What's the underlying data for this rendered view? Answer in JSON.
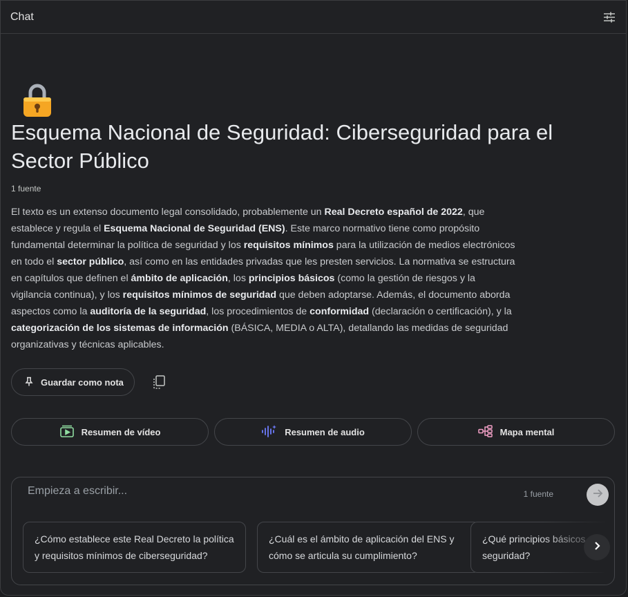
{
  "header": {
    "title": "Chat",
    "settings_icon": "tune-sliders-icon"
  },
  "notebook": {
    "emoji_icon": "lock-icon",
    "title": "Esquema Nacional de Seguridad: Ciberseguridad para el Sector Público",
    "source_count": "1 fuente",
    "summary_parts": [
      {
        "t": "El texto es un extenso documento legal consolidado, probablemente un ",
        "b": false
      },
      {
        "t": "Real Decreto español de 2022",
        "b": true
      },
      {
        "t": ", que establece y regula el ",
        "b": false
      },
      {
        "t": "Esquema Nacional de Seguridad (ENS)",
        "b": true
      },
      {
        "t": ". Este marco normativo tiene como propósito fundamental determinar la política de seguridad y los ",
        "b": false
      },
      {
        "t": "requisitos mínimos",
        "b": true
      },
      {
        "t": " para la utilización de medios electrónicos en todo el ",
        "b": false
      },
      {
        "t": "sector público",
        "b": true
      },
      {
        "t": ", así como en las entidades privadas que les presten servicios. La normativa se estructura en capítulos que definen el ",
        "b": false
      },
      {
        "t": "ámbito de aplicación",
        "b": true
      },
      {
        "t": ", los ",
        "b": false
      },
      {
        "t": "principios básicos",
        "b": true
      },
      {
        "t": " (como la gestión de riesgos y la vigilancia continua), y los ",
        "b": false
      },
      {
        "t": "requisitos mínimos de seguridad",
        "b": true
      },
      {
        "t": " que deben adoptarse. Además, el documento aborda aspectos como la ",
        "b": false
      },
      {
        "t": "auditoría de la seguridad",
        "b": true
      },
      {
        "t": ", los procedimientos de ",
        "b": false
      },
      {
        "t": "conformidad",
        "b": true
      },
      {
        "t": " (declaración o certificación), y la ",
        "b": false
      },
      {
        "t": "categorización de los sistemas de información",
        "b": true
      },
      {
        "t": " (BÁSICA, MEDIA o ALTA), detallando las medidas de seguridad organizativas y técnicas aplicables.",
        "b": false
      }
    ]
  },
  "actions": {
    "save_note_label": "Guardar como nota",
    "save_note_icon": "pin-icon",
    "copy_icon": "copy-icon"
  },
  "studio": [
    {
      "label": "Resumen de vídeo",
      "icon": "video-summary-icon",
      "color": "#8fdca0"
    },
    {
      "label": "Resumen de audio",
      "icon": "audio-waveform-icon",
      "color": "#6f7dff"
    },
    {
      "label": "Mapa mental",
      "icon": "mind-map-icon",
      "color": "#f2a0c6"
    }
  ],
  "composer": {
    "placeholder": "Empieza a escribir...",
    "source_count": "1 fuente",
    "send_icon": "arrow-right-icon",
    "suggestions": [
      "¿Cómo establece este Real Decreto la política y requisitos mínimos de ciberseguridad?",
      "¿Cuál es el ámbito de aplicación del ENS y cómo se articula su cumplimiento?",
      "¿Qué principios básicos guían la gestión de la seguridad?"
    ],
    "next_icon": "chevron-right-icon"
  }
}
